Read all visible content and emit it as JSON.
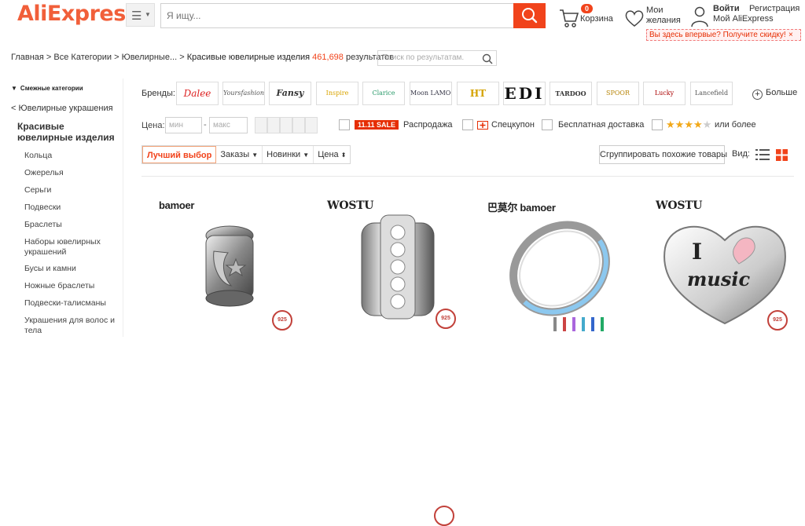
{
  "header": {
    "logo": "AliExpress",
    "logo_tm": "™",
    "search_placeholder": "Я ищу...",
    "cart_count": "0",
    "cart_label": "Корзина",
    "wishlist_label": "Мои желания",
    "login": "Войти",
    "register": "Регистрация",
    "my_account": "Мой AliExpress",
    "promo": "Вы здесь впервые? Получите скидку!",
    "promo_close": "×",
    "accent": "#f1431b"
  },
  "breadcrumb": {
    "items": [
      "Главная",
      "Все Категории",
      "Ювелирные..."
    ],
    "sep": " > ",
    "current": "Красивые ювелирные изделия",
    "count": "461,698",
    "count_suffix": "результатов",
    "sub_search_placeholder": "Поиск по результатам."
  },
  "sidebar": {
    "heading": "Смежные категории",
    "back_link": "< Ювелирные украшения",
    "current": "Красивые ювелирные изделия",
    "items": [
      "Кольца",
      "Ожерелья",
      "Серьги",
      "Подвески",
      "Браслеты",
      "Наборы ювелирных украшений",
      "Бусы и камни",
      "Ножные браслеты",
      "Подвески-талисманы",
      "Украшения для волос и тела"
    ]
  },
  "filters": {
    "brands_label": "Бренды:",
    "brands": [
      "Dalee",
      "Yoursfashion",
      "Fansy",
      "Inspire",
      "Clarice",
      "Moon LAMOON",
      "HT",
      "EDI",
      "TARDOO",
      "SPOOR",
      "Lucky",
      "Lancefield"
    ],
    "more": "Больше",
    "price_label": "Цена:",
    "price_min": "мин",
    "price_max": "макс",
    "price_dash": "-",
    "sale_badge": "11.11 SALE",
    "sale_label": "Распродажа",
    "coupon_label": "Спецкупон",
    "free_shipping": "Бесплатная доставка",
    "rating_suffix": "или более",
    "rating": 4
  },
  "sort": {
    "options": [
      "Лучший выбор",
      "Заказы",
      "Новинки",
      "Цена"
    ],
    "active": "Лучший выбор",
    "group_label": "Сгруппировать похожие товары",
    "view_label": "Вид:"
  },
  "products": [
    {
      "brand": "bamoer",
      "badge": "925"
    },
    {
      "brand": "WOSTU",
      "badge": "925"
    },
    {
      "brand": "巴莫尔 bamoer",
      "badge": "925"
    },
    {
      "brand": "WOSTU",
      "badge": "925",
      "engraving": "I music"
    }
  ]
}
